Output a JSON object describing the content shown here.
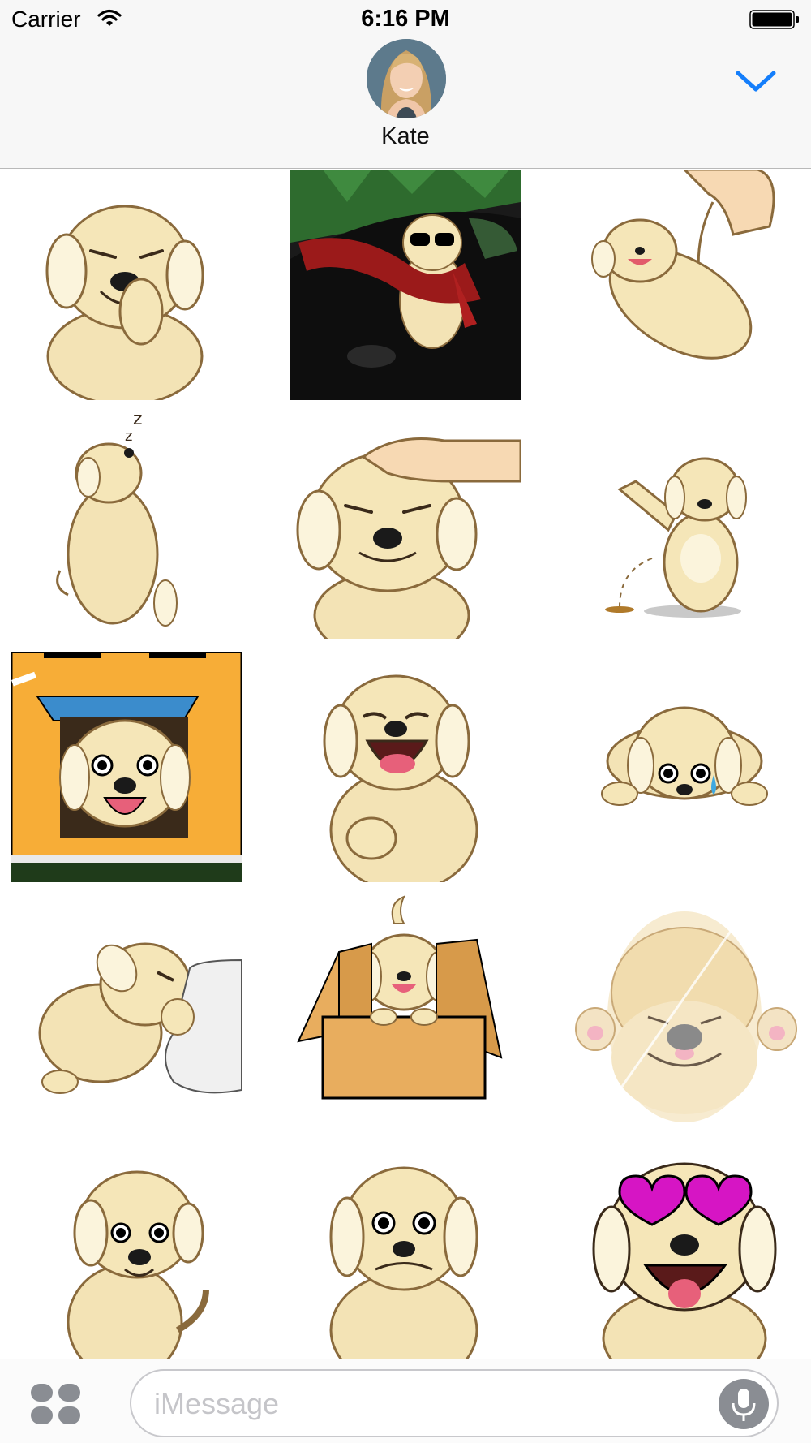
{
  "status_bar": {
    "carrier": "Carrier",
    "time": "6:16 PM",
    "wifi_icon": "wifi-icon",
    "battery_icon": "battery-full-icon"
  },
  "header": {
    "contact_name": "Kate",
    "collapse_icon": "chevron-down-icon",
    "accent_color": "#147efb"
  },
  "stickers": [
    {
      "id": "puppy-giggling"
    },
    {
      "id": "puppy-sunglasses-car"
    },
    {
      "id": "puppy-tickled"
    },
    {
      "id": "puppy-sleeping"
    },
    {
      "id": "puppy-petted"
    },
    {
      "id": "puppy-peeing"
    },
    {
      "id": "puppy-door-window"
    },
    {
      "id": "puppy-laughing"
    },
    {
      "id": "puppy-crying"
    },
    {
      "id": "puppy-hugging-pillow"
    },
    {
      "id": "puppy-in-box"
    },
    {
      "id": "puppy-pressed-on-glass"
    },
    {
      "id": "puppy-curious"
    },
    {
      "id": "puppy-nervous"
    },
    {
      "id": "puppy-heart-eyes"
    }
  ],
  "input_bar": {
    "placeholder": "iMessage",
    "apps_icon": "app-drawer-icon",
    "mic_icon": "microphone-icon"
  }
}
